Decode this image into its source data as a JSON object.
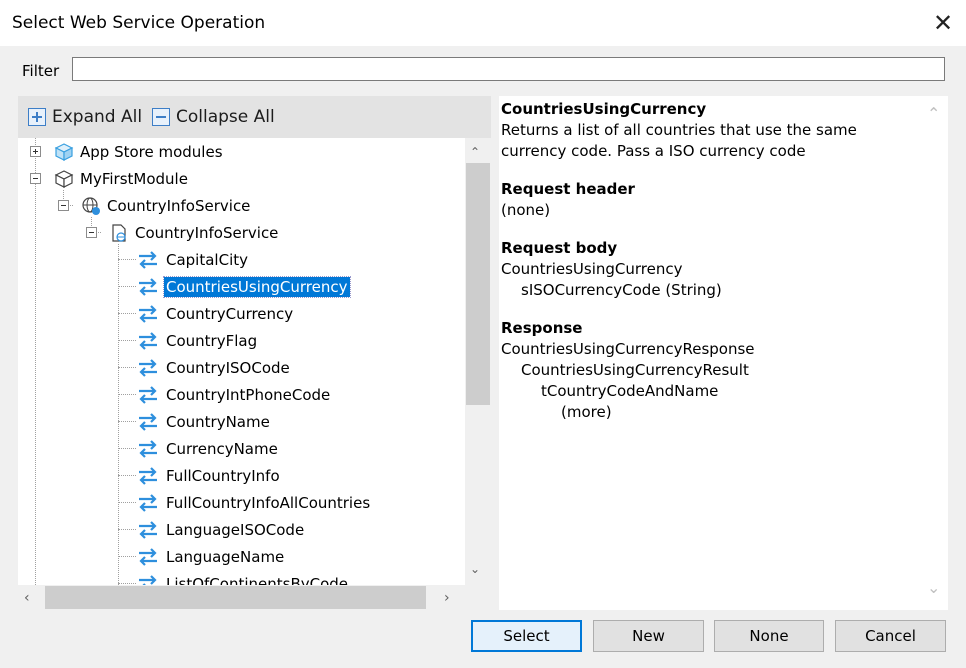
{
  "window": {
    "title": "Select Web Service Operation",
    "close_glyph": "✕"
  },
  "filter": {
    "label": "Filter",
    "value": "",
    "placeholder": ""
  },
  "toolbar": {
    "expand_all": "Expand All",
    "collapse_all": "Collapse All"
  },
  "tree": {
    "app_store_modules": "App Store modules",
    "my_first_module": "MyFirstModule",
    "service_folder": "CountryInfoService",
    "service_doc": "CountryInfoService",
    "operations": [
      "CapitalCity",
      "CountriesUsingCurrency",
      "CountryCurrency",
      "CountryFlag",
      "CountryISOCode",
      "CountryIntPhoneCode",
      "CountryName",
      "CurrencyName",
      "FullCountryInfo",
      "FullCountryInfoAllCountries",
      "LanguageISOCode",
      "LanguageName",
      "ListOfContinentsByCode"
    ],
    "selected": "CountriesUsingCurrency"
  },
  "details": {
    "name": "CountriesUsingCurrency",
    "description_line1": "Returns a list of all countries that use the same",
    "description_line2": "currency code. Pass a ISO currency code",
    "request_header_title": "Request header",
    "request_header_value": "(none)",
    "request_body_title": "Request body",
    "request_body_lines": [
      "CountriesUsingCurrency",
      "sISOCurrencyCode (String)"
    ],
    "response_title": "Response",
    "response_lines": [
      "CountriesUsingCurrencyResponse",
      "CountriesUsingCurrencyResult",
      "tCountryCodeAndName",
      "(more)"
    ]
  },
  "buttons": {
    "select": "Select",
    "new": "New",
    "none": "None",
    "cancel": "Cancel"
  },
  "colors": {
    "selection": "#0078d7",
    "arrow_icon": "#2e8fdd",
    "panel_bg": "#e3e3e3"
  },
  "icons": {
    "expand_all": "plus-box-icon",
    "collapse_all": "minus-box-icon",
    "operation": "exchange-arrows-icon"
  }
}
